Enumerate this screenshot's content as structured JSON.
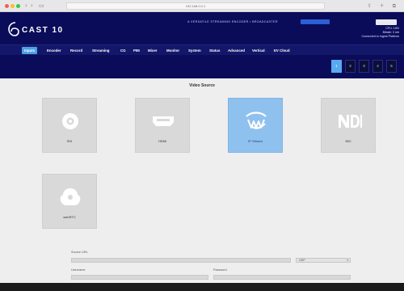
{
  "browser": {
    "url": "192.168.0.0.1",
    "icons": "⇧ ＋ ⧉"
  },
  "header": {
    "logo_text": "CAST 10",
    "promo_text": "A VERSATILE STREAMING ENCODER • BROADCASTER",
    "status_lines": [
      "CPU: 18%",
      "Bitrate: 3 mb",
      "Connected to Ingest Platform"
    ]
  },
  "nav": {
    "items": [
      {
        "label": "Inputs",
        "active": true
      },
      {
        "label": "Encoder",
        "active": false
      },
      {
        "label": "Record",
        "active": false
      },
      {
        "label": "Streaming",
        "active": false
      },
      {
        "label": "CG",
        "active": false
      },
      {
        "label": "PIM",
        "active": false
      },
      {
        "label": "Mixer",
        "active": false
      },
      {
        "label": "Monitor",
        "active": false
      },
      {
        "label": "System",
        "active": false
      },
      {
        "label": "Status",
        "active": false
      },
      {
        "label": "Advanced",
        "active": false
      },
      {
        "label": "Vertical",
        "active": false
      },
      {
        "label": "EV Cloud",
        "active": false
      }
    ]
  },
  "steps": [
    {
      "label": "1",
      "active": true
    },
    {
      "label": "2",
      "active": false
    },
    {
      "label": "3",
      "active": false
    },
    {
      "label": "4",
      "active": false
    },
    {
      "label": "5",
      "active": false
    }
  ],
  "main": {
    "section_title": "Video Source",
    "tiles": [
      {
        "label": "SDI",
        "icon": "sdi-icon",
        "selected": false
      },
      {
        "label": "HDMI",
        "icon": "hdmi-icon",
        "selected": false
      },
      {
        "label": "IP Stream",
        "icon": "ip-stream-icon",
        "selected": true
      },
      {
        "label": "NDI",
        "icon": "ndi-icon",
        "selected": false
      },
      {
        "label": "webRTC",
        "icon": "webrtc-icon",
        "selected": false
      }
    ],
    "form": {
      "source_url_label": "Source URL",
      "protocol_value": "UDP",
      "username_label": "Username",
      "password_label": "Password"
    }
  },
  "colors": {
    "header_bg": "#0a0c5a",
    "nav_bg": "#13176a",
    "accent": "#4d9fe6",
    "selected_tile": "#8fc1ee",
    "tile_bg": "#d9d9d9"
  }
}
